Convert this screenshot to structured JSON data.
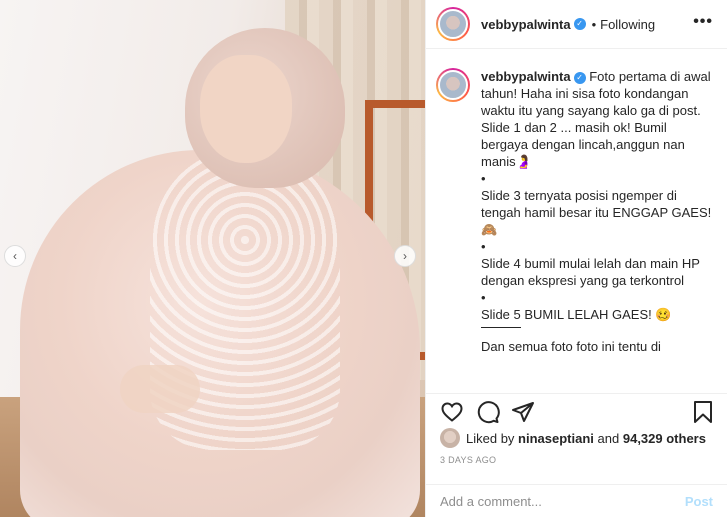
{
  "post": {
    "username": "vebbypalwinta",
    "following_label": "Following",
    "dot": "•",
    "more_label": "•••",
    "caption_lines": [
      "Foto pertama di awal tahun! Haha ini sisa foto kondangan waktu itu yang sayang kalo ga di post.",
      "Slide 1 dan 2 ... masih ok! Bumil bergaya dengan lincah,anggun nan manis🤰",
      "•",
      "Slide 3 ternyata posisi ngemper di tengah hamil besar itu ENGGAP GAES! 🙈",
      "•",
      "Slide 4 bumil mulai lelah dan main HP dengan ekspresi yang ga terkontrol",
      "•",
      "Slide 5 BUMIL LELAH GAES! 🥴",
      "Dan semua foto foto ini tentu di"
    ],
    "liked_by_prefix": "Liked by",
    "liked_by_user": "ninaseptiani",
    "liked_by_and": "and",
    "liked_by_count": "94,329 others",
    "date": "3 DAYS AGO",
    "comment_placeholder": "Add a comment...",
    "post_button": "Post"
  },
  "icons": {
    "verified": "verified-badge-icon",
    "prev": "chevron-left-icon",
    "next": "chevron-right-icon",
    "like": "heart-icon",
    "comment": "comment-icon",
    "share": "share-icon",
    "save": "bookmark-icon"
  },
  "colors": {
    "accent": "#3897f0",
    "post_button": "#b2dffc",
    "muted": "#8e8e8e"
  }
}
